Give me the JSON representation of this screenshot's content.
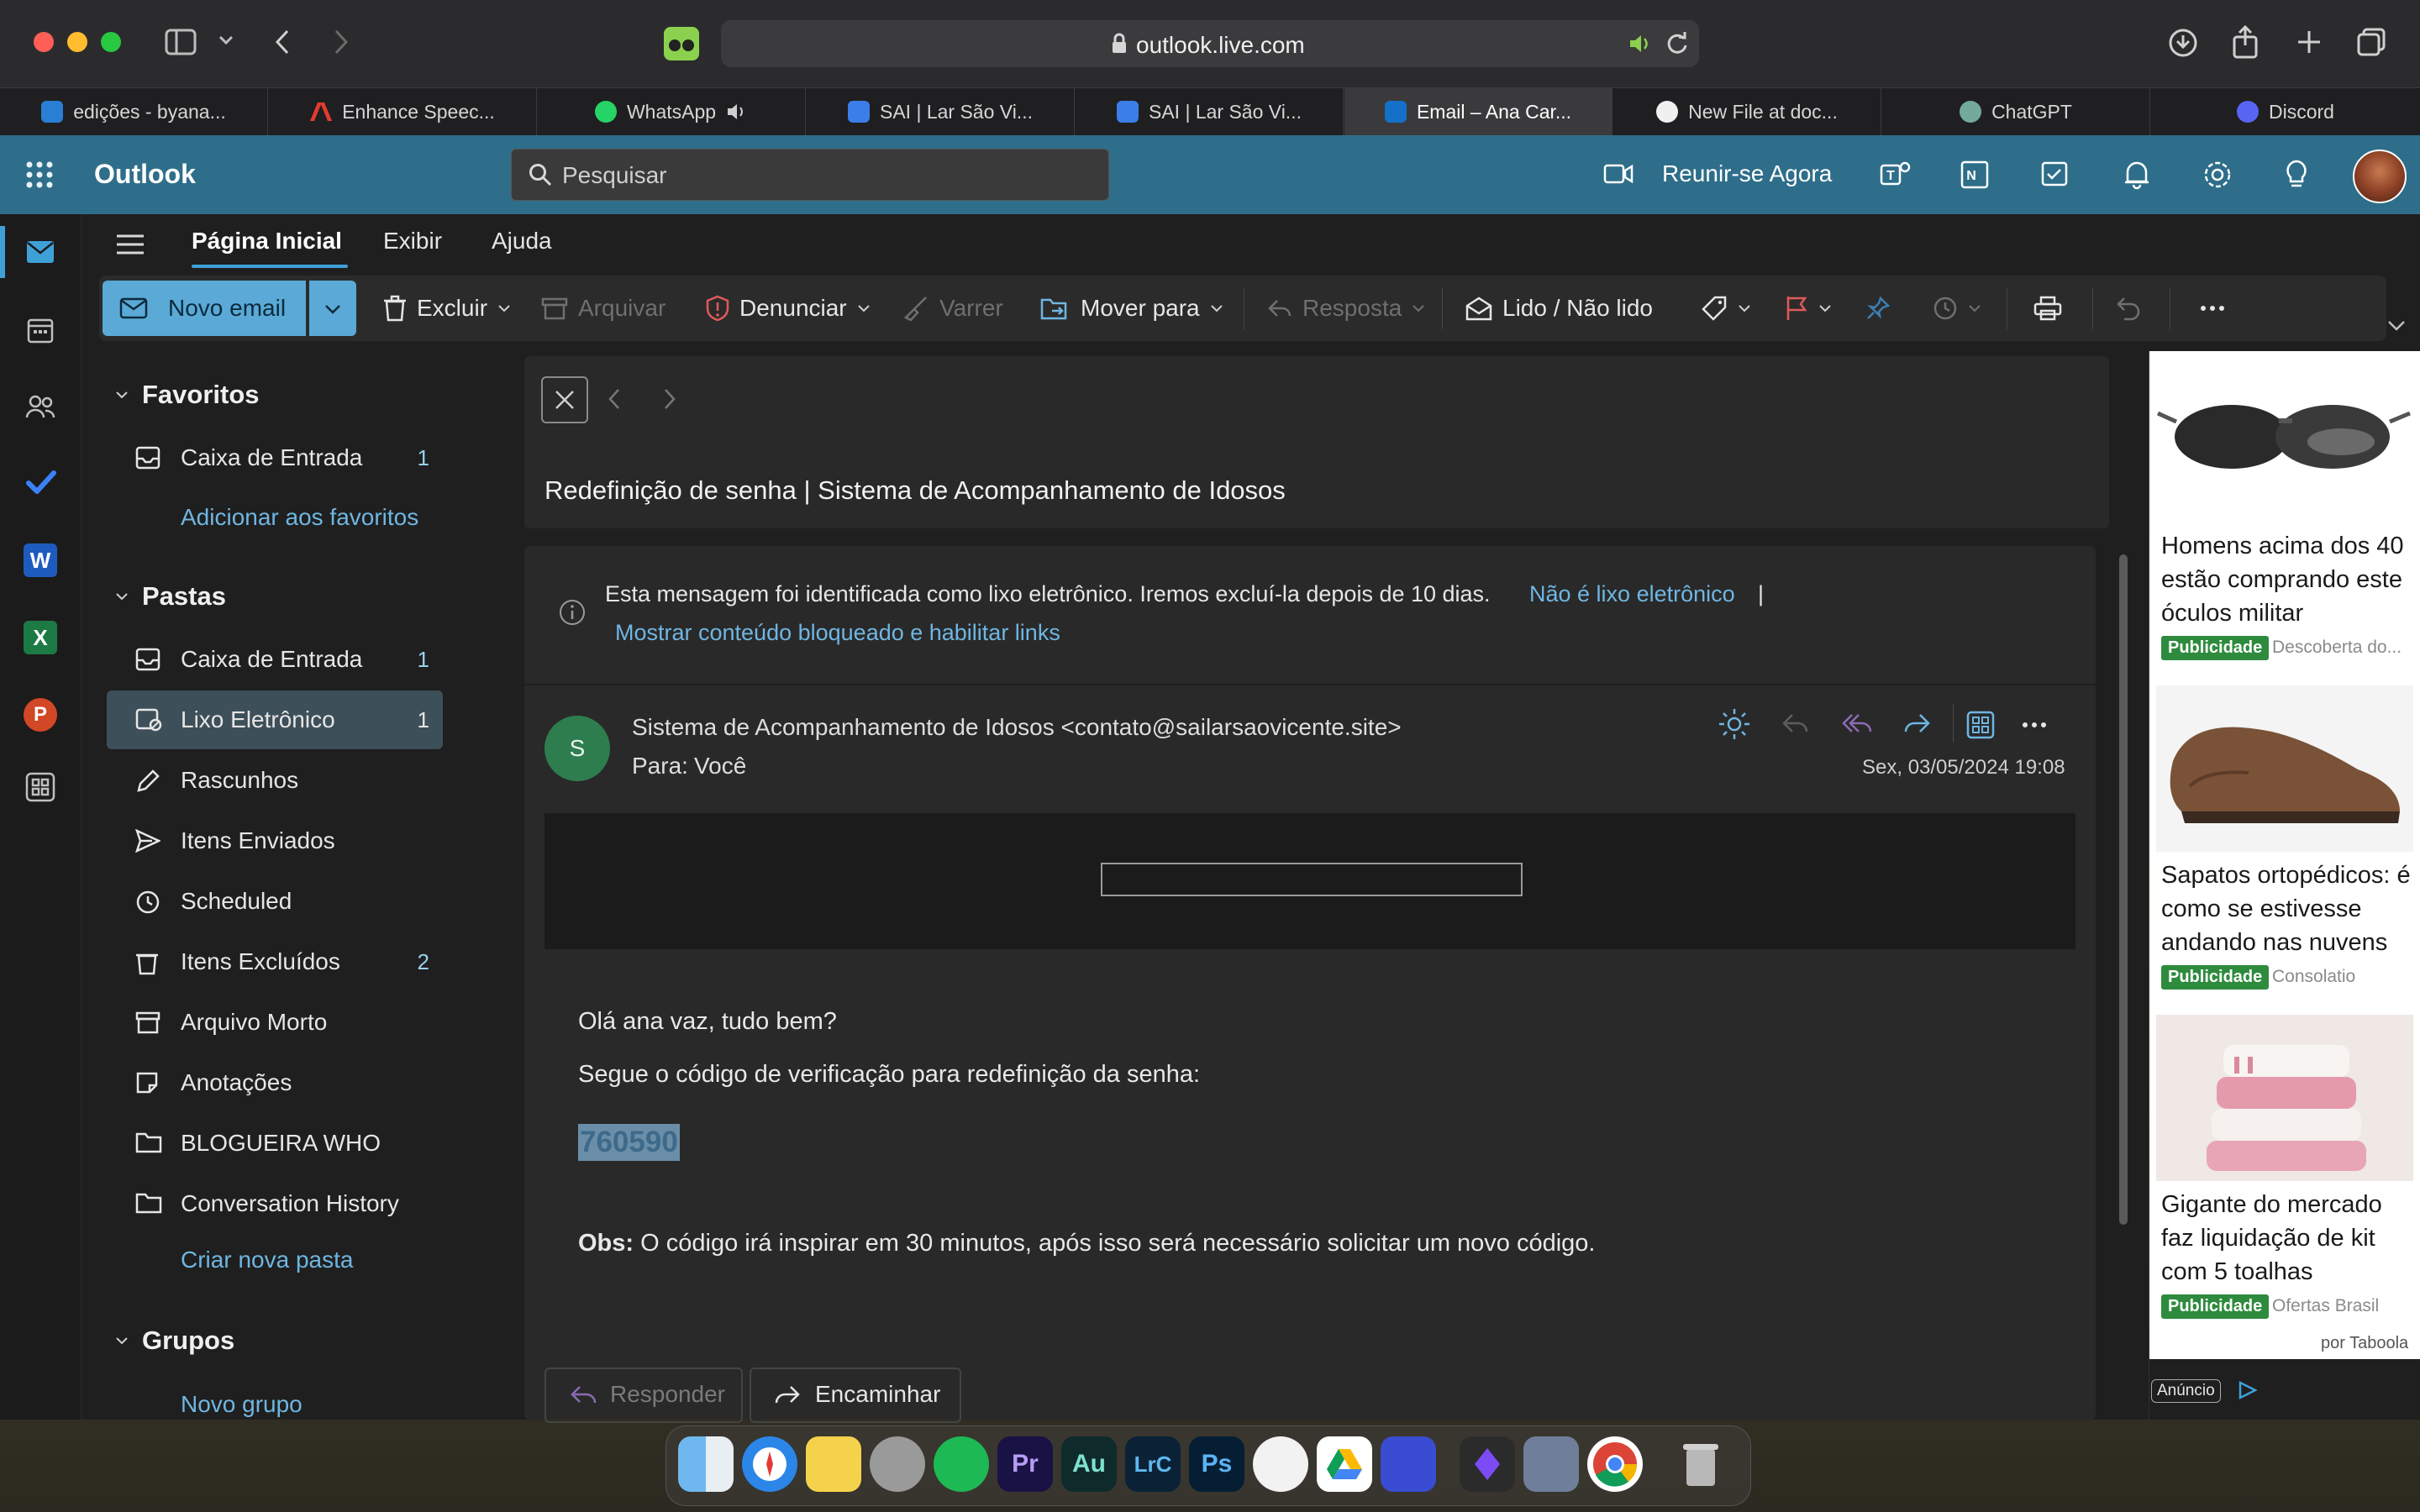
{
  "browser": {
    "url": "outlook.live.com",
    "tabs": [
      {
        "label": "edições - byana..."
      },
      {
        "label": "Enhance Speec..."
      },
      {
        "label": "WhatsApp"
      },
      {
        "label": "SAI | Lar São Vi..."
      },
      {
        "label": "SAI | Lar São Vi..."
      },
      {
        "label": "Email – Ana Car..."
      },
      {
        "label": "New File at doc..."
      },
      {
        "label": "ChatGPT"
      },
      {
        "label": "Discord"
      }
    ]
  },
  "header": {
    "app_name": "Outlook",
    "search_placeholder": "Pesquisar",
    "meet_now": "Reunir-se Agora"
  },
  "menu_tabs": [
    "Página Inicial",
    "Exibir",
    "Ajuda"
  ],
  "ribbon": {
    "new_email": "Novo email",
    "delete": "Excluir",
    "archive": "Arquivar",
    "report": "Denunciar",
    "sweep": "Varrer",
    "move_to": "Mover para",
    "reply": "Resposta",
    "read_unread": "Lido / Não lido"
  },
  "folders": {
    "favorites_title": "Favoritos",
    "favorites": [
      {
        "label": "Caixa de Entrada",
        "count": "1"
      }
    ],
    "add_favorites": "Adicionar aos favoritos",
    "folders_title": "Pastas",
    "items": [
      {
        "label": "Caixa de Entrada",
        "count": "1"
      },
      {
        "label": "Lixo Eletrônico",
        "count": "1"
      },
      {
        "label": "Rascunhos",
        "count": ""
      },
      {
        "label": "Itens Enviados",
        "count": ""
      },
      {
        "label": "Scheduled",
        "count": ""
      },
      {
        "label": "Itens Excluídos",
        "count": "2"
      },
      {
        "label": "Arquivo Morto",
        "count": ""
      },
      {
        "label": "Anotações",
        "count": ""
      },
      {
        "label": "BLOGUEIRA WHO",
        "count": ""
      },
      {
        "label": "Conversation History",
        "count": ""
      }
    ],
    "create_folder": "Criar nova pasta",
    "groups_title": "Grupos",
    "new_group": "Novo grupo"
  },
  "message": {
    "subject": "Redefinição de senha | Sistema de Acompanhamento de Idosos",
    "junk_notice": "Esta mensagem foi identificada como lixo eletrônico. Iremos excluí-la depois de 10 dias.",
    "not_junk": "Não é lixo eletrônico",
    "separator": "|",
    "show_blocked": "Mostrar conteúdo bloqueado e habilitar links",
    "avatar_letter": "S",
    "sender": "Sistema de Acompanhamento de Idosos <contato@sailarsaovicente.site>",
    "to_label": "Para:",
    "to_value": "Você",
    "date": "Sex, 03/05/2024 19:08",
    "greeting": "Olá ana vaz, tudo bem?",
    "line1": "Segue o código de verificação para redefinição da senha:",
    "code": "760590",
    "obs_label": "Obs:",
    "obs_text": "O código irá inspirar em 30 minutos, após isso será necessário solicitar um novo código.",
    "reply_button": "Responder",
    "forward_button": "Encaminhar"
  },
  "ads": {
    "items": [
      {
        "title": "Homens acima dos 40 estão comprando este óculos militar",
        "badge": "Publicidade",
        "source": "Descoberta do..."
      },
      {
        "title": "Sapatos ortopédicos: é como se estivesse andando nas nuvens",
        "badge": "Publicidade",
        "source": "Consolatio"
      },
      {
        "title": "Gigante do mercado faz liquidação de kit com 5 toalhas",
        "badge": "Publicidade",
        "source": "Ofertas Brasil"
      }
    ],
    "by": "por Taboola",
    "ad_label": "Anúncio"
  },
  "dock": {
    "premiere": "Pr",
    "audition": "Au",
    "lightroom": "LrC",
    "photoshop": "Ps"
  },
  "colors": {
    "outlook_header": "#2e6e8a",
    "accent_blue": "#3fa0d8",
    "selected_folder": "#3d4f58",
    "link": "#6fb6e2",
    "sender_avatar": "#2e7d4f",
    "ad_badge": "#2e8b3d"
  }
}
